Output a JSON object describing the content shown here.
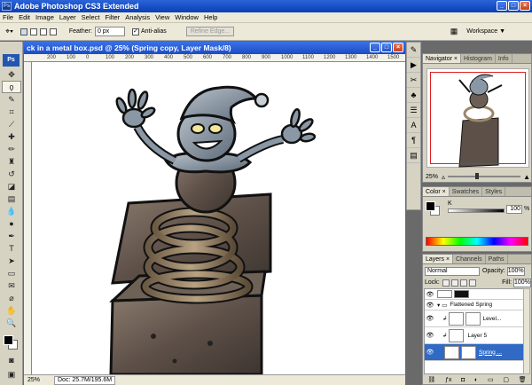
{
  "app": {
    "title": "Adobe Photoshop CS3 Extended"
  },
  "menu": [
    "File",
    "Edit",
    "Image",
    "Layer",
    "Select",
    "Filter",
    "Analysis",
    "View",
    "Window",
    "Help"
  ],
  "options": {
    "feather_label": "Feather:",
    "feather_value": "0 px",
    "antialias_label": "Anti-alias",
    "refine_label": "Refine Edge...",
    "workspace_label": "Workspace ▼"
  },
  "tools": {
    "logo": "Ps"
  },
  "document": {
    "title": "ck in a metal box.psd @ 25% (Spring copy, Layer Mask/8)",
    "ruler_ticks": [
      "200",
      "100",
      "0",
      "100",
      "200",
      "300",
      "400",
      "500",
      "600",
      "700",
      "800",
      "900",
      "1000",
      "1100",
      "1200",
      "1300",
      "1400",
      "1500"
    ],
    "zoom": "25%",
    "doc_info": "Doc: 25.7M/195.6M"
  },
  "navigator": {
    "tabs": [
      "Navigator ×",
      "Histogram",
      "Info"
    ],
    "zoom": "25%"
  },
  "color_panel": {
    "tabs": [
      "Color ×",
      "Swatches",
      "Styles"
    ],
    "channel_label": "K",
    "value": "100",
    "unit": "%"
  },
  "layers_panel": {
    "tabs": [
      "Layers ×",
      "Channels",
      "Paths"
    ],
    "blend_mode": "Normal",
    "opacity_label": "Opacity:",
    "opacity_value": "100%",
    "lock_label": "Lock:",
    "fill_label": "Fill:",
    "fill_value": "100%",
    "layers": [
      {
        "name": "",
        "kind": "mask"
      },
      {
        "name": "Flattened Spring",
        "kind": "group"
      },
      {
        "name": "Level...",
        "kind": "adjust"
      },
      {
        "name": "Layer 5",
        "kind": "normal"
      },
      {
        "name": "Spring ...",
        "kind": "selected"
      }
    ]
  }
}
